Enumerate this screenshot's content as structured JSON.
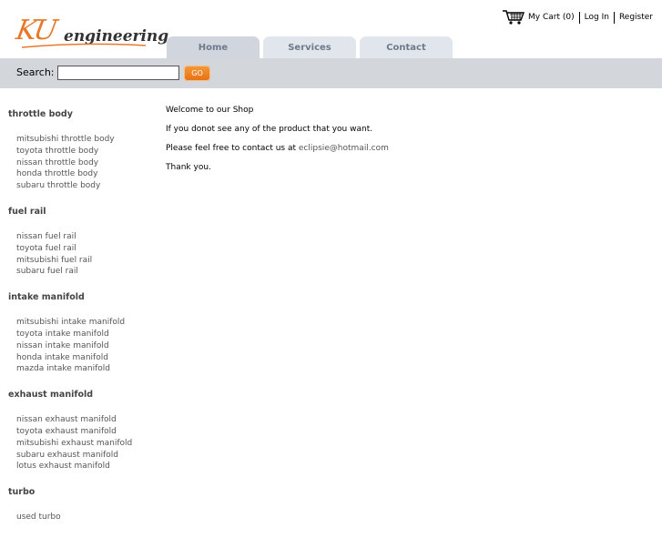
{
  "brand": {
    "logo_main": "KU",
    "logo_sub": "engineering",
    "accent": "#e8792a"
  },
  "nav": {
    "tabs": [
      {
        "label": "Home",
        "active": true
      },
      {
        "label": "Services",
        "active": false
      },
      {
        "label": "Contact",
        "active": false
      }
    ]
  },
  "toplinks": {
    "cart": "My Cart (0)",
    "login": "Log In",
    "register": "Register"
  },
  "search": {
    "label": "Search:",
    "value": "",
    "placeholder": "",
    "go_label": "GO"
  },
  "sidebar": {
    "categories": [
      {
        "title": "throttle body",
        "items": [
          "mitsubishi throttle body",
          "toyota throttle body",
          "nissan throttle body",
          "honda throttle body",
          "subaru throttle body"
        ]
      },
      {
        "title": "fuel rail",
        "items": [
          "nissan fuel rail",
          "toyota fuel rail",
          "mitsubishi fuel rail",
          "subaru fuel rail"
        ]
      },
      {
        "title": "intake manifold",
        "items": [
          "mitsubishi intake manifold",
          "toyota intake manifold",
          "nissan intake manifold",
          "honda intake manifold",
          "mazda intake manifold"
        ]
      },
      {
        "title": "exhaust manifold",
        "items": [
          "nissan exhaust manifold",
          "toyota exhaust manifold",
          "mitsubishi exhaust manifold",
          "subaru exhaust manifold",
          "lotus exhaust manifold"
        ]
      },
      {
        "title": "turbo",
        "items": [
          "used turbo"
        ]
      }
    ]
  },
  "content": {
    "welcome": "Welcome to our Shop",
    "line2": "If you donot see any of the product that you want.",
    "line3_prefix": "Please feel free to contact us at ",
    "email": "eclipsie@hotmail.com",
    "thanks": "Thank you."
  }
}
